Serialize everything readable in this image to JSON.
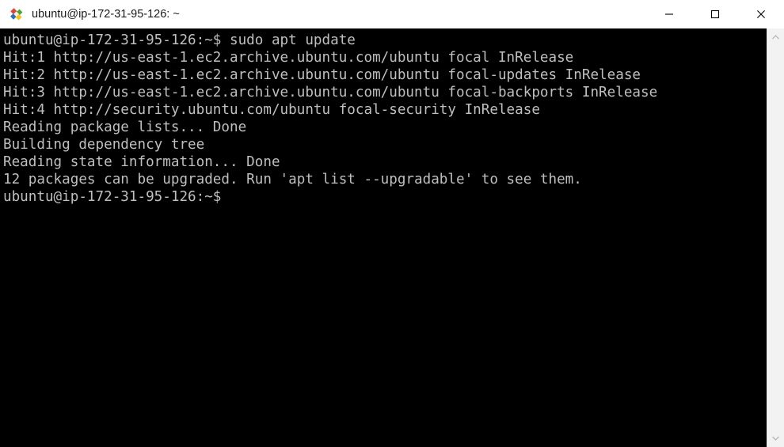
{
  "window": {
    "title": "ubuntu@ip-172-31-95-126: ~",
    "icon": "putty-app-icon",
    "background_color": "#000000",
    "titlebar_color": "#ffffff"
  },
  "titlebar": {
    "minimize_label": "Minimize",
    "maximize_label": "Maximize",
    "close_label": "Close",
    "minimize_icon": "minimize-icon",
    "maximize_icon": "maximize-icon",
    "close_icon": "close-icon"
  },
  "terminal": {
    "foreground_color": "#bfbfbf",
    "background_color": "#000000",
    "lines": [
      "ubuntu@ip-172-31-95-126:~$ sudo apt update",
      "Hit:1 http://us-east-1.ec2.archive.ubuntu.com/ubuntu focal InRelease",
      "Hit:2 http://us-east-1.ec2.archive.ubuntu.com/ubuntu focal-updates InRelease",
      "Hit:3 http://us-east-1.ec2.archive.ubuntu.com/ubuntu focal-backports InRelease",
      "Hit:4 http://security.ubuntu.com/ubuntu focal-security InRelease",
      "Reading package lists... Done",
      "Building dependency tree",
      "Reading state information... Done",
      "12 packages can be upgraded. Run 'apt list --upgradable' to see them.",
      "ubuntu@ip-172-31-95-126:~$"
    ]
  },
  "scrollbar": {
    "up_arrow_icon": "chevron-up-icon",
    "down_arrow_icon": "chevron-down-icon",
    "orientation": "vertical"
  }
}
